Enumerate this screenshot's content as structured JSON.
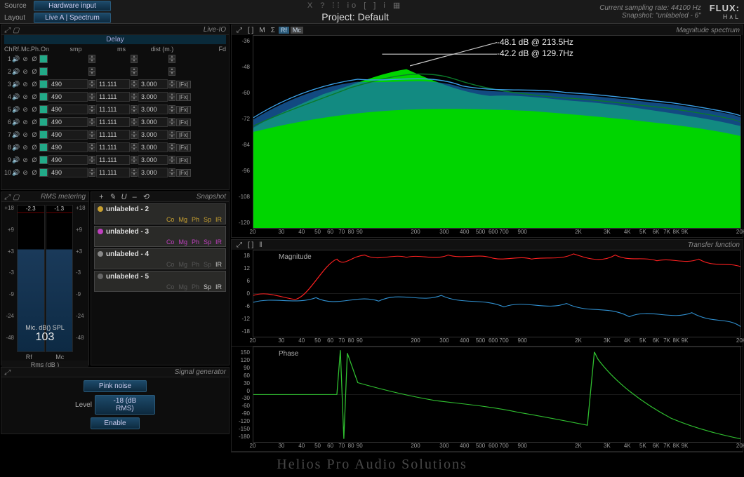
{
  "topbar": {
    "source_label": "Source",
    "source_btn": "Hardware input",
    "layout_label": "Layout",
    "layout_btn": "Live A | Spectrum",
    "icons": "X ? ⁞⁞ io [ ] i ▦",
    "project": "Project: Default",
    "rate": "Current sampling rate: 44100 Hz",
    "snapshot": "Snapshot: \"unlabeled - 6\"",
    "brand": "FLUX:",
    "subbrand": "H∧L"
  },
  "liveio": {
    "title": "Live-IO",
    "delay_hdr": "Delay",
    "cols": {
      "ch": "Ch.",
      "rf": "Rf.",
      "mc": "Mc.",
      "ph": "Ph.",
      "on": "On",
      "smp": "smp",
      "ms": "ms",
      "dist": "dist (m.)",
      "fd": "Fd"
    },
    "rows": [
      {
        "n": 1,
        "blank": true
      },
      {
        "n": 2,
        "blank": true
      },
      {
        "n": 3,
        "smp": "490",
        "ms": "11.111",
        "dist": "3.000"
      },
      {
        "n": 4,
        "smp": "490",
        "ms": "11.111",
        "dist": "3.000"
      },
      {
        "n": 5,
        "smp": "490",
        "ms": "11.111",
        "dist": "3.000"
      },
      {
        "n": 6,
        "smp": "490",
        "ms": "11.111",
        "dist": "3.000"
      },
      {
        "n": 7,
        "smp": "490",
        "ms": "11.111",
        "dist": "3.000"
      },
      {
        "n": 8,
        "smp": "490",
        "ms": "11.111",
        "dist": "3.000"
      },
      {
        "n": 9,
        "smp": "490",
        "ms": "11.111",
        "dist": "3.000"
      },
      {
        "n": 10,
        "smp": "490",
        "ms": "11.111",
        "dist": "3.000"
      }
    ],
    "fx": "|Fx|"
  },
  "rms": {
    "title": "RMS metering",
    "peak_l": "-2.3",
    "peak_r": "-1.3",
    "scale": [
      "+18",
      "+9",
      "+3",
      "-3",
      "-9",
      "-24",
      "-48"
    ],
    "spl_label": "Mic. dB() SPL",
    "spl_val": "103",
    "rf": "Rf",
    "mc": "Mc",
    "footer": "Rms (dB )"
  },
  "snapshot": {
    "title": "Snapshot",
    "tools": [
      "+",
      "✎",
      "U",
      "–",
      "⟲"
    ],
    "items": [
      {
        "name": "unlabeled - 2",
        "dot": "#c8a030",
        "labels": [
          [
            "Co",
            "#c8a030"
          ],
          [
            "Mg",
            "#c8a030"
          ],
          [
            "Ph",
            "#c8a030"
          ],
          [
            "Sp",
            "#c8a030"
          ],
          [
            "IR",
            "#c8a030"
          ]
        ]
      },
      {
        "name": "unlabeled - 3",
        "dot": "#c040c0",
        "labels": [
          [
            "Co",
            "#c040c0"
          ],
          [
            "Mg",
            "#c040c0"
          ],
          [
            "Ph",
            "#c040c0"
          ],
          [
            "Sp",
            "#c040c0"
          ],
          [
            "IR",
            "#c040c0"
          ]
        ]
      },
      {
        "name": "unlabeled - 4",
        "dot": "#888",
        "labels": [
          [
            "Co",
            "#555"
          ],
          [
            "Mg",
            "#555"
          ],
          [
            "Ph",
            "#555"
          ],
          [
            "Sp",
            "#555"
          ],
          [
            "IR",
            "#ccc"
          ]
        ]
      },
      {
        "name": "unlabeled - 5",
        "dot": "#666",
        "labels": [
          [
            "Co",
            "#555"
          ],
          [
            "Mg",
            "#555"
          ],
          [
            "Ph",
            "#555"
          ],
          [
            "Sp",
            "#ccc"
          ],
          [
            "IR",
            "#ccc"
          ]
        ]
      }
    ]
  },
  "siggen": {
    "title": "Signal generator",
    "noise": "Pink noise",
    "level_label": "Level",
    "level_val": "-18 (dB RMS)",
    "enable": "Enable"
  },
  "spectrum": {
    "title": "Magnitude spectrum",
    "tools": [
      "⤢",
      "[ ]",
      "M",
      "Σ"
    ],
    "rf": "Rf",
    "mc": "Mc",
    "yticks": [
      "-36",
      "-48",
      "-60",
      "-72",
      "-84",
      "-96",
      "-108",
      "-120"
    ],
    "cursor1": "-48.1 dB @ 213.5Hz",
    "cursor2": "-42.2 dB @ 129.7Hz"
  },
  "transfer": {
    "title": "Transfer function",
    "tools": [
      "⤢",
      "[ ]",
      "‖"
    ],
    "mag_label": "Magnitude",
    "phase_label": "Phase",
    "mag_ticks": [
      "18",
      "12",
      "6",
      "0",
      "-6",
      "-12",
      "-18"
    ],
    "phase_ticks": [
      "150",
      "120",
      "90",
      "60",
      "30",
      "0",
      "-30",
      "-60",
      "-90",
      "-120",
      "-150",
      "-180"
    ]
  },
  "xaxis": {
    "ticks": [
      [
        "20",
        0
      ],
      [
        "30",
        6.1
      ],
      [
        "40",
        10.4
      ],
      [
        "50",
        13.8
      ],
      [
        "60",
        16.5
      ],
      [
        "70",
        18.9
      ],
      [
        "80",
        20.9
      ],
      [
        "90",
        22.7
      ],
      [
        "200",
        34.6
      ],
      [
        "300",
        40.7
      ],
      [
        "400",
        45
      ],
      [
        "500",
        48.4
      ],
      [
        "600",
        51.1
      ],
      [
        "700",
        53.4
      ],
      [
        "900",
        57.3
      ],
      [
        "2K",
        69.2
      ],
      [
        "3K",
        75.3
      ],
      [
        "4K",
        79.6
      ],
      [
        "5K",
        82.9
      ],
      [
        "6K",
        85.7
      ],
      [
        "7K",
        88
      ],
      [
        "8K",
        90
      ],
      [
        "9K",
        91.8
      ],
      [
        "20K",
        103.8
      ]
    ]
  },
  "watermark": "Helios Pro Audio Solutions",
  "chart_data": {
    "spectrum": {
      "type": "line",
      "xscale": "log",
      "xrange": [
        20,
        20000
      ],
      "yrange": [
        -120,
        -36
      ],
      "cursors": [
        {
          "x": 213.5,
          "y": -48.1
        },
        {
          "x": 129.7,
          "y": -42.2
        }
      ],
      "series": [
        {
          "name": "Rf-fill",
          "color": "#00FF00",
          "style": "area",
          "note": "green fill rising from -120 to about -55..-65 across band"
        },
        {
          "name": "Mc-fill",
          "color": "#1a6ab8",
          "style": "area",
          "note": "blue translucent fill -60..-50 mid band"
        },
        {
          "name": "Rf-line",
          "color": "#10B050",
          "style": "line"
        },
        {
          "name": "Mc-line",
          "color": "#3AA0E8",
          "style": "line"
        }
      ]
    },
    "transfer_mag": {
      "type": "line",
      "xscale": "log",
      "xrange": [
        20,
        20000
      ],
      "yrange": [
        -18,
        18
      ],
      "series": [
        {
          "name": "red",
          "color": "#FF2020"
        },
        {
          "name": "blue",
          "color": "#3090D0"
        }
      ]
    },
    "transfer_phase": {
      "type": "line",
      "xscale": "log",
      "xrange": [
        20,
        20000
      ],
      "yrange": [
        -180,
        180
      ],
      "series": [
        {
          "name": "green",
          "color": "#30C030"
        }
      ]
    }
  }
}
